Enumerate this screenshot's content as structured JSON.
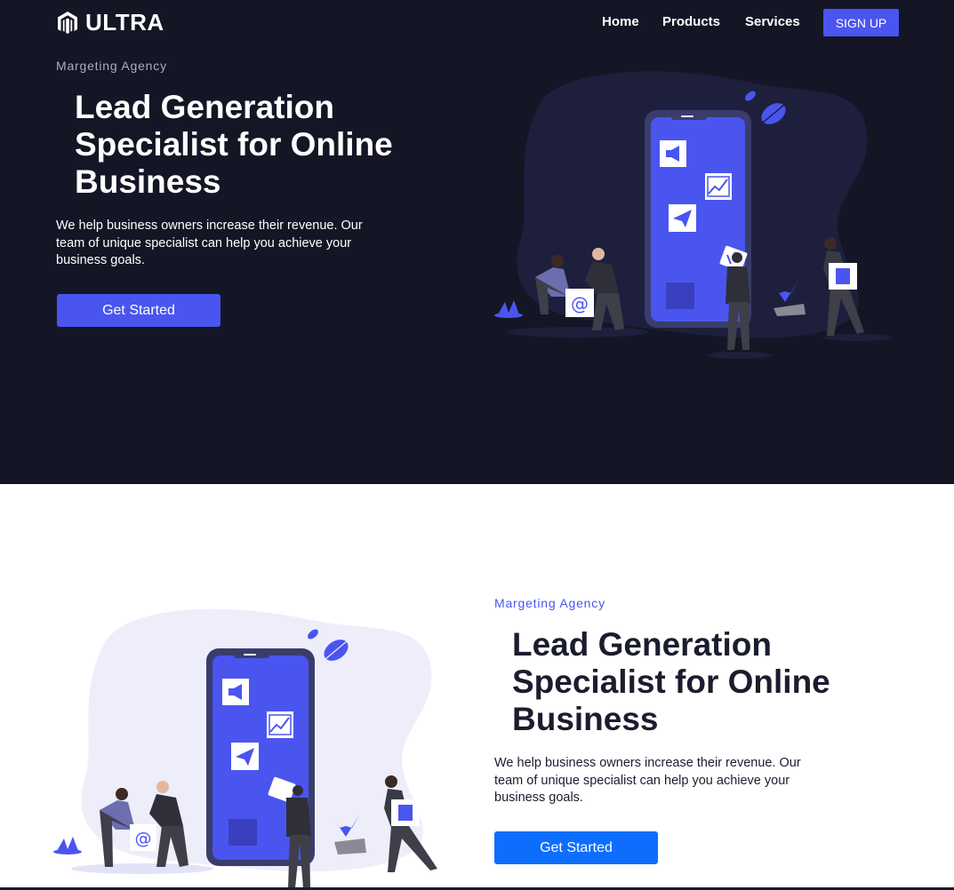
{
  "brand": {
    "name": "ULTRA",
    "icon": "magento-logo-icon"
  },
  "nav": {
    "items": [
      {
        "label": "Home"
      },
      {
        "label": "Products"
      },
      {
        "label": "Services"
      }
    ],
    "signup_label": "SIGN UP"
  },
  "hero_dark": {
    "eyebrow": "Margeting Agency",
    "title": "Lead Generation Specialist for Online Business",
    "body": "We help business owners increase their revenue. Our team of unique specialist can help you achieve your business goals.",
    "cta_label": "Get Started"
  },
  "hero_light": {
    "eyebrow": "Margeting Agency",
    "title": "Lead Generation Specialist for Online Business",
    "body": "We help business owners increase their revenue. Our team of unique specialist can help you achieve your business goals.",
    "cta_label": "Get Started"
  },
  "illustration": {
    "email_glyph": "@",
    "icons": [
      "megaphone-icon",
      "chart-icon",
      "paper-plane-icon",
      "bar-chart-icon",
      "building-icon"
    ]
  },
  "colors": {
    "dark_bg": "#141625",
    "accent": "#4a55f0",
    "cta_blue": "#0d6efd",
    "blob_dark": "#1d1f3d",
    "blob_light": "#eeeefb"
  }
}
